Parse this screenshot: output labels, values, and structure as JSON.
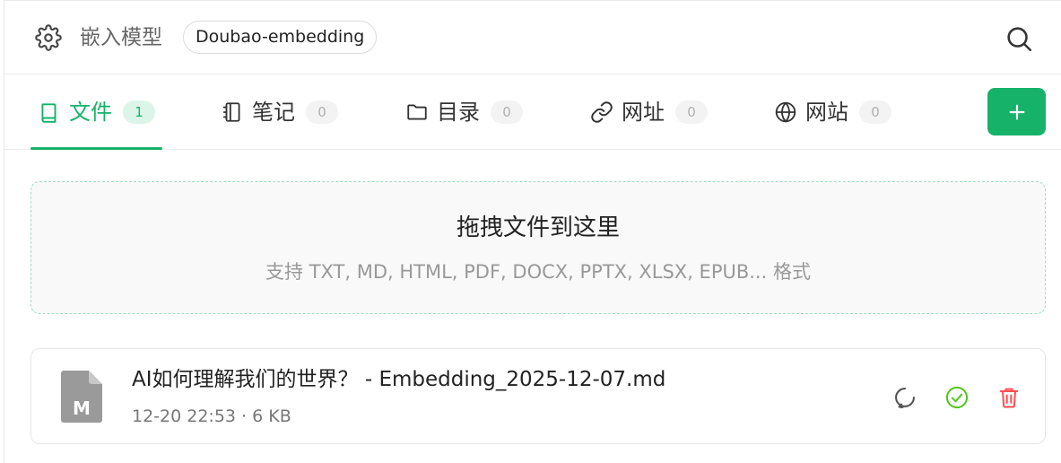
{
  "header": {
    "settings_icon": "gear-icon",
    "title": "嵌入模型",
    "model": "Doubao-embedding",
    "search_icon": "search-icon"
  },
  "tabs": [
    {
      "label": "文件",
      "count": "1",
      "icon": "book-icon",
      "active": true
    },
    {
      "label": "笔记",
      "count": "0",
      "icon": "notebook-icon",
      "active": false
    },
    {
      "label": "目录",
      "count": "0",
      "icon": "folder-icon",
      "active": false
    },
    {
      "label": "网址",
      "count": "0",
      "icon": "link-icon",
      "active": false
    },
    {
      "label": "网站",
      "count": "0",
      "icon": "globe-icon",
      "active": false
    }
  ],
  "add_button": {
    "icon": "plus-icon"
  },
  "dropzone": {
    "title": "拖拽文件到这里",
    "subtitle": "支持 TXT, MD, HTML, PDF, DOCX, PPTX, XLSX, EPUB... 格式"
  },
  "files": [
    {
      "icon_letter": "M",
      "name": "AI如何理解我们的世界？ - Embedding_2025-12-07.md",
      "meta": "12-20 22:53 · 6 KB",
      "actions": [
        "refresh-icon",
        "check-circle-icon",
        "trash-icon"
      ]
    }
  ],
  "colors": {
    "accent": "#17b26a",
    "success": "#52c41a",
    "danger": "#ff4d4f",
    "muted": "#999999"
  }
}
